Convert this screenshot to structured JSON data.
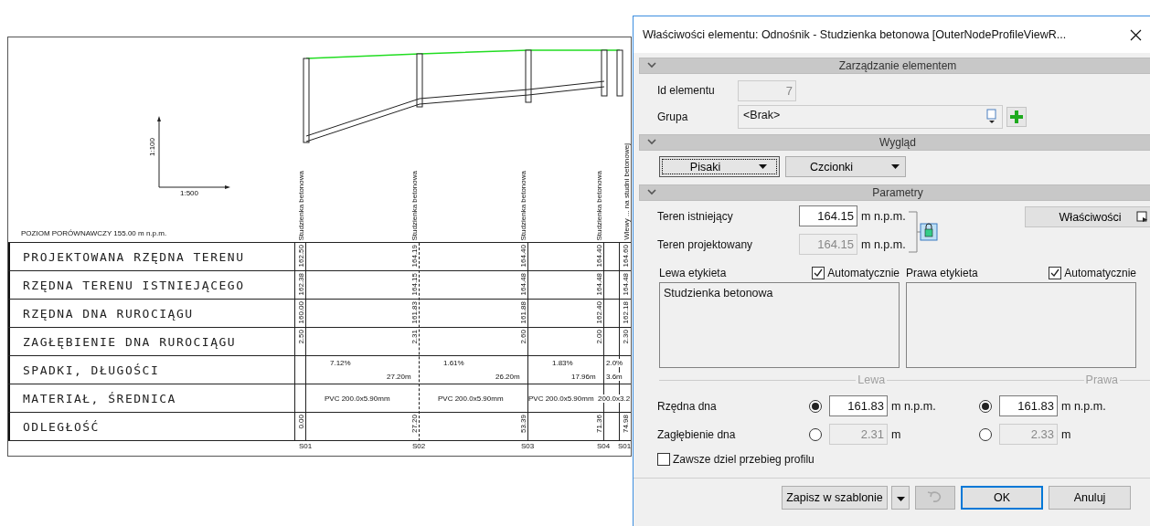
{
  "drawing": {
    "scale_labels": [
      "1:100",
      "1:500"
    ],
    "reference_level": "POZIOM PORÓWNAWCZY 155.00 m n.p.m.",
    "stations": [
      {
        "name": "S01",
        "label": "Studzienka betonowa",
        "dashed": false
      },
      {
        "name": "S02",
        "label": "Studzienka betonowa",
        "dashed": true
      },
      {
        "name": "S03",
        "label": "Studzienka betonowa",
        "dashed": false
      },
      {
        "name": "S04",
        "label": "Studzienka betonowa",
        "dashed": false
      },
      {
        "name": "S01",
        "label": "Wlewy ... na studni betonowej",
        "dashed": false
      }
    ],
    "rows": [
      {
        "kind": "values",
        "label": "PROJEKTOWANA RZĘDNA TERENU",
        "values": [
          "162.50",
          "164.19",
          "164.40",
          "164.40",
          "164.60"
        ]
      },
      {
        "kind": "values",
        "label": "RZĘDNA TERENU ISTNIEJĄCEGO",
        "values": [
          "162.38",
          "164.15",
          "164.48",
          "164.48",
          "164.48"
        ]
      },
      {
        "kind": "values",
        "label": "RZĘDNA DNA RUROCIĄGU",
        "values": [
          "160.00",
          "161.83",
          "161.88",
          "162.40",
          "162.18"
        ]
      },
      {
        "kind": "values",
        "label": "ZAGŁĘBIENIE DNA RUROCIĄGU",
        "values": [
          "2.50",
          "2.31",
          "2.60",
          "2.00",
          "2.30"
        ]
      },
      {
        "kind": "slopes",
        "label": "SPADKI, DŁUGOŚCI"
      },
      {
        "kind": "materials",
        "label": "MATERIAŁ, ŚREDNICA"
      },
      {
        "kind": "values",
        "label": "ODLEGŁOŚĆ",
        "values": [
          "0.00",
          "27.20",
          "53.39",
          "71.36",
          "74.98"
        ]
      }
    ],
    "segments": [
      {
        "slope": "7.12%",
        "length": "27.20m",
        "material": "PVC 200.0x5.90mm"
      },
      {
        "slope": "1.61%",
        "length": "26.20m",
        "material": "PVC 200.0x5.90mm"
      },
      {
        "slope": "1.83%",
        "length": "17.96m",
        "material": "PVC 200.0x5.90mm"
      },
      {
        "slope": "2.0%",
        "length": "3.6m",
        "material": "200.0x3.2"
      }
    ]
  },
  "dialog": {
    "title": "Właściwości elementu: Odnośnik - Studzienka betonowa [OuterNodeProfileViewR...",
    "sections": [
      {
        "kind": "management",
        "title": "Zarządzanie elementem",
        "expanded": true
      },
      {
        "kind": "appearance",
        "title": "Wygląd",
        "expanded": true
      },
      {
        "kind": "parameters",
        "title": "Parametry",
        "expanded": true
      }
    ],
    "management": {
      "id_label": "Id elementu",
      "id_value": "7",
      "group_label": "Grupa",
      "group_value": "<Brak>"
    },
    "appearance": {
      "buttons": [
        {
          "label": "Pisaki",
          "focused": true
        },
        {
          "label": "Czcionki",
          "focused": false
        }
      ]
    },
    "parameters": {
      "terrain": [
        {
          "label": "Teren istniejący",
          "value": "164.15",
          "unit": "m n.p.m.",
          "disabled": false
        },
        {
          "label": "Teren projektowany",
          "value": "164.15",
          "unit": "m n.p.m.",
          "disabled": true
        }
      ],
      "properties_button": "Właściwości",
      "labels": [
        {
          "title": "Lewa etykieta",
          "auto_label": "Automatycznie",
          "checked": true,
          "text": "Studzienka betonowa"
        },
        {
          "title": "Prawa etykieta",
          "auto_label": "Automatycznie",
          "checked": true
        }
      ],
      "columns": [
        "Lewa",
        "Prawa"
      ],
      "rows": [
        {
          "label": "Rzędna dna",
          "cells": [
            {
              "selected": true,
              "value": "161.83",
              "unit": "m n.p.m."
            },
            {
              "selected": true,
              "value": "161.83",
              "unit": "m n.p.m."
            }
          ]
        },
        {
          "label": "Zagłębienie dna",
          "cells": [
            {
              "selected": false,
              "value": "2.31",
              "unit": "m"
            },
            {
              "selected": false,
              "value": "2.33",
              "unit": "m"
            }
          ]
        }
      ],
      "split": {
        "label": "Zawsze dziel przebieg profilu",
        "checked": false
      }
    },
    "footer": {
      "save_template": "Zapisz w szablonie",
      "ok": "OK",
      "cancel": "Anuluj",
      "undo_disabled": true
    }
  }
}
